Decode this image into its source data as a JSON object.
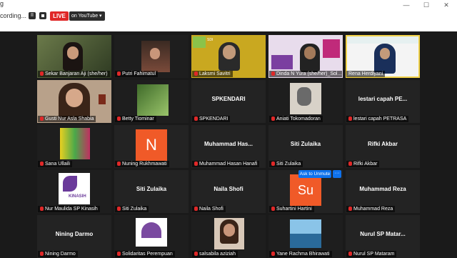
{
  "toolbar": {
    "recording_label": "cording...",
    "pause_label": "II",
    "live_label": "LIVE",
    "stream_target": "on YouTube ▾",
    "corner_text": "g",
    "minimize_label": "—",
    "maximize_label": "☐",
    "close_label": "✕"
  },
  "participants": [
    {
      "name": "Sekar Banjaran Aji (she/her)",
      "kind": "video"
    },
    {
      "name": "Putri Fahimatul",
      "kind": "video"
    },
    {
      "name": "Laksmi Savitri",
      "kind": "video"
    },
    {
      "name": "Dinda N Yura (she/her)_Sol...",
      "kind": "video"
    },
    {
      "name": "Rena Herdiyani",
      "kind": "video",
      "active": true
    },
    {
      "name": "Gusti Nur Asla Shabia",
      "kind": "video"
    },
    {
      "name": "Betty Tiominar",
      "kind": "video"
    },
    {
      "name": "SPKENDARI",
      "kind": "text",
      "display": "SPKENDARI"
    },
    {
      "name": "Aniati Tokomadoran",
      "kind": "video"
    },
    {
      "name": "lestari capah PETRASA",
      "kind": "text",
      "display": "lestari capah PE..."
    },
    {
      "name": "Sana Ullaili",
      "kind": "video"
    },
    {
      "name": "Nuning Rukhmawati",
      "kind": "avatar",
      "initial": "N",
      "color": "#f05a28"
    },
    {
      "name": "Muhammad Hasan Hanafi",
      "kind": "text",
      "display": "Muhammad Has..."
    },
    {
      "name": "Siti Zulaika",
      "kind": "text",
      "display": "Siti Zulaika"
    },
    {
      "name": "Rifki Akbar",
      "kind": "text",
      "display": "Rifki Akbar"
    },
    {
      "name": "Nur Maulida SP Kinasih",
      "kind": "video"
    },
    {
      "name": "Siti Zulaika",
      "kind": "text",
      "display": "Siti Zulaika"
    },
    {
      "name": "Naila Shofi",
      "kind": "text",
      "display": "Naila Shofi"
    },
    {
      "name": "Suhartini Hartini",
      "kind": "avatar",
      "initial": "Su",
      "color": "#f05a28"
    },
    {
      "name": "Muhammad Reza",
      "kind": "text",
      "display": "Muhammad Reza"
    },
    {
      "name": "Nining Darmo",
      "kind": "text",
      "display": "Nining Darmo"
    },
    {
      "name": "Solidaritas Perempuan",
      "kind": "video"
    },
    {
      "name": "salsabila aziziah",
      "kind": "video"
    },
    {
      "name": "Yane Rachma Bhirawati",
      "kind": "video"
    },
    {
      "name": "Nurul SP Mataram",
      "kind": "text",
      "display": "Nurul SP Matar..."
    }
  ],
  "hover_menu": {
    "unmute_label": "Ask to Unmute",
    "more_label": "···"
  },
  "tile_badges": {
    "sdi": "SDI",
    "kinasih": "KINASIH"
  },
  "colors": {
    "active_speaker": "#f2d34a",
    "live": "#e02828",
    "avatar": "#f05a28",
    "button_blue": "#0e72ed"
  }
}
